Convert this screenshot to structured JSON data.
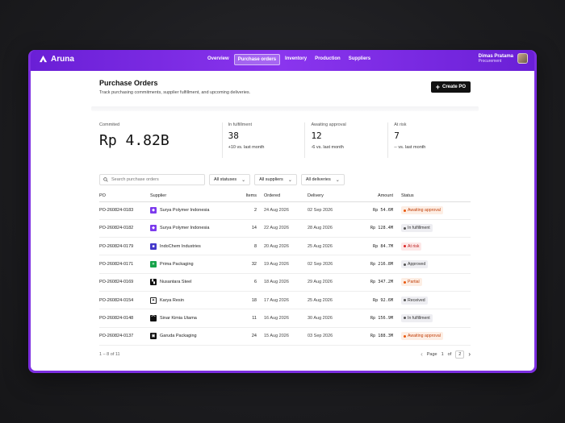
{
  "app": {
    "brand": "Aruna"
  },
  "nav": [
    {
      "label": "Overview",
      "active": false
    },
    {
      "label": "Purchase orders",
      "active": true
    },
    {
      "label": "Inventory",
      "active": false
    },
    {
      "label": "Production",
      "active": false
    },
    {
      "label": "Suppliers",
      "active": false
    }
  ],
  "user": {
    "name": "Dimas Pratama",
    "role": "Procurement"
  },
  "page": {
    "title": "Purchase Orders",
    "subtitle": "Track purchasing commitments, supplier fulfillment, and upcoming deliveries.",
    "create_label": "Create PO"
  },
  "stats": {
    "committed": {
      "label": "Commited",
      "value": "Rp 4.82B"
    },
    "fulfillment": {
      "label": "In fulfillment",
      "value": "38",
      "delta": "+10 vs. last month"
    },
    "approval": {
      "label": "Awaiting approval",
      "value": "12",
      "delta": "-6 vs. last month"
    },
    "risk": {
      "label": "At risk",
      "value": "7",
      "delta": "-- vs. last month"
    }
  },
  "filters": {
    "search_placeholder": "Search purchase orders",
    "statuses": "All statuses",
    "suppliers": "All suppliers",
    "deliveries": "All deliveries"
  },
  "table": {
    "headers": {
      "po": "PO",
      "supplier": "Supplier",
      "items": "Items",
      "ordered": "Ordered",
      "delivery": "Delivery",
      "amount": "Amount",
      "status": "Status"
    },
    "rows": [
      {
        "po": "PO-260824-0183",
        "supplier": "Surya Polymer Indonesia",
        "logo_color": "#7c3aed",
        "logo_glyph": "◆",
        "items": "2",
        "ordered": "24 Aug 2026",
        "delivery": "02 Sep 2026",
        "amount": "Rp 54.6M",
        "status": "Awaiting approval",
        "status_bg": "#fdeee4",
        "status_fg": "#c2410c",
        "status_dot": "#ea580c"
      },
      {
        "po": "PO-260824-0182",
        "supplier": "Surya Polymer Indonesia",
        "logo_color": "#7c3aed",
        "logo_glyph": "◆",
        "items": "14",
        "ordered": "22 Aug 2026",
        "delivery": "28 Aug 2026",
        "amount": "Rp 128.4M",
        "status": "In fulfillment",
        "status_bg": "#eeeef2",
        "status_fg": "#333",
        "status_dot": "#555"
      },
      {
        "po": "PO-260824-0179",
        "supplier": "IndoChem Industries",
        "logo_color": "#4338ca",
        "logo_glyph": "■",
        "items": "8",
        "ordered": "20 Aug 2026",
        "delivery": "25 Aug 2026",
        "amount": "Rp 84.7M",
        "status": "At risk",
        "status_bg": "#fde8e8",
        "status_fg": "#b91c1c",
        "status_dot": "#dc2626"
      },
      {
        "po": "PO-260824-0171",
        "supplier": "Prima Packaging",
        "logo_color": "#16a34a",
        "logo_glyph": "+",
        "items": "32",
        "ordered": "19 Aug 2026",
        "delivery": "02 Sep 2026",
        "amount": "Rp 216.8M",
        "status": "Approved",
        "status_bg": "#eeeef2",
        "status_fg": "#333",
        "status_dot": "#555"
      },
      {
        "po": "PO-260824-0169",
        "supplier": "Nusantara Steel",
        "logo_color": "#111111",
        "logo_glyph": "▚",
        "items": "6",
        "ordered": "18 Aug 2026",
        "delivery": "29 Aug 2026",
        "amount": "Rp 347.2M",
        "status": "Partial",
        "status_bg": "#fdeee4",
        "status_fg": "#c2410c",
        "status_dot": "#ea580c"
      },
      {
        "po": "PO-260824-0154",
        "supplier": "Karya Resin",
        "logo_color": "#ffffff",
        "logo_glyph": "✦",
        "items": "18",
        "ordered": "17 Aug 2026",
        "delivery": "25 Aug 2026",
        "amount": "Rp 92.6M",
        "status": "Received",
        "status_bg": "#eeeef2",
        "status_fg": "#333",
        "status_dot": "#555"
      },
      {
        "po": "PO-260824-0148",
        "supplier": "Sinar Kimia Utama",
        "logo_color": "#111111",
        "logo_glyph": "⌒",
        "items": "11",
        "ordered": "16 Aug 2026",
        "delivery": "30 Aug 2026",
        "amount": "Rp 156.9M",
        "status": "In fulfillment",
        "status_bg": "#eeeef2",
        "status_fg": "#333",
        "status_dot": "#555"
      },
      {
        "po": "PO-260824-0137",
        "supplier": "Garuda Packaging",
        "logo_color": "#111111",
        "logo_glyph": "▣",
        "items": "24",
        "ordered": "15 Aug 2026",
        "delivery": "03 Sep 2026",
        "amount": "Rp 188.3M",
        "status": "Awaiting approval",
        "status_bg": "#fdeee4",
        "status_fg": "#c2410c",
        "status_dot": "#ea580c"
      }
    ]
  },
  "footer": {
    "count": "1 – 8 of 11",
    "page_label": "Page",
    "page": "1",
    "of": "of",
    "total": "2"
  }
}
